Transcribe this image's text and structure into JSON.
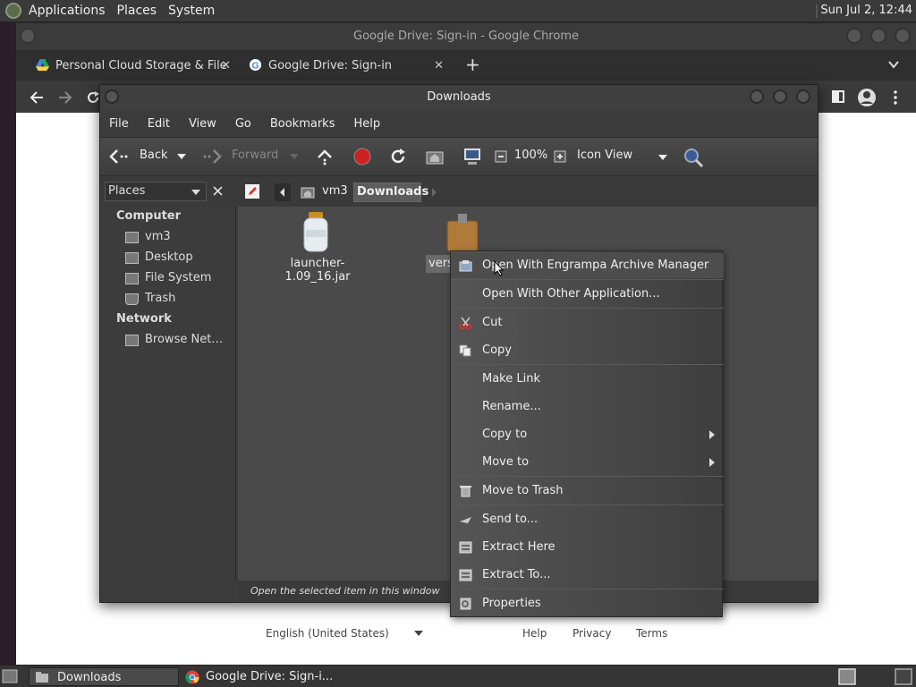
{
  "top_panel": {
    "menus": [
      "Applications",
      "Places",
      "System"
    ],
    "clock": "Sun Jul  2, 12:44"
  },
  "chrome": {
    "window_title": "Google Drive: Sign-in - Google Chrome",
    "tabs": [
      {
        "label": "Personal Cloud Storage & File"
      },
      {
        "label": "Google Drive: Sign-in"
      }
    ],
    "close_glyph": "✕",
    "new_tab_glyph": "+",
    "footer": {
      "language": "English (United States)",
      "links": [
        "Help",
        "Privacy",
        "Terms"
      ]
    }
  },
  "caja": {
    "title": "Downloads",
    "menubar": [
      "File",
      "Edit",
      "View",
      "Go",
      "Bookmarks",
      "Help"
    ],
    "toolbar": {
      "back": "Back",
      "forward": "Forward",
      "zoom": "100%",
      "view_mode": "Icon View"
    },
    "places_label": "Places",
    "breadcrumb": [
      "vm3",
      "Downloads"
    ],
    "sidebar": {
      "computer_heading": "Computer",
      "computer_items": [
        "vm3",
        "Desktop",
        "File System",
        "Trash"
      ],
      "network_heading": "Network",
      "network_items": [
        "Browse Net…"
      ]
    },
    "files": [
      {
        "name": "launcher-1.09_16.jar"
      },
      {
        "name": "vers"
      }
    ],
    "status": "Open the selected item in this window"
  },
  "context_menu": {
    "items": [
      "Open With Engrampa Archive Manager",
      "Open With Other Application...",
      "Cut",
      "Copy",
      "Make Link",
      "Rename...",
      "Copy to",
      "Move to",
      "Move to Trash",
      "Send to...",
      "Extract Here",
      "Extract To...",
      "Properties"
    ]
  },
  "taskbar": {
    "tasks": [
      "Downloads",
      "Google Drive: Sign-i..."
    ]
  },
  "colors": {
    "accent_red": "#cc2222",
    "accent_blue": "#4a8fd8"
  }
}
